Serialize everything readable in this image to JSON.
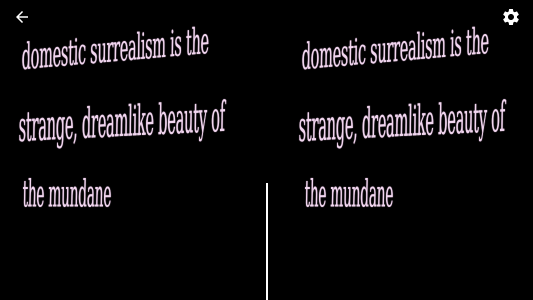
{
  "app": {
    "view_mode": "VR stereoscopic split view"
  },
  "toolbar": {
    "back_icon": "arrow-left-icon",
    "settings_icon": "gear-icon",
    "icon_color": "#ffffff"
  },
  "scene": {
    "background_color": "#000000",
    "text_color": "#f1d6ef",
    "divider_color": "#ffffff",
    "quote_lines": [
      "domestic surrealism is the",
      "strange, dreamlike beauty of",
      "the mundane"
    ]
  }
}
